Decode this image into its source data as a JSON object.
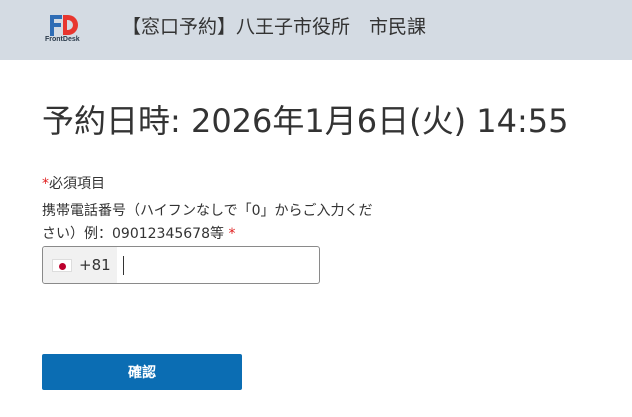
{
  "header": {
    "logo_text": "FrontDesk",
    "title": "【窓口予約】八王子市役所　市民課",
    "background": "#d4dbe3"
  },
  "reservation": {
    "title": "予約日時: 2026年1月6日(火) 14:55"
  },
  "form": {
    "required_mark": "*",
    "required_note": "必須項目",
    "phone_label": "携帯電話番号（ハイフンなしで「0」からご入力ください）例：09012345678等",
    "country_flag": "jp-flag-icon",
    "country_code": "+81",
    "phone_value": "",
    "phone_placeholder": ""
  },
  "actions": {
    "confirm_label": "確認",
    "confirm_color": "#0b6db3"
  }
}
